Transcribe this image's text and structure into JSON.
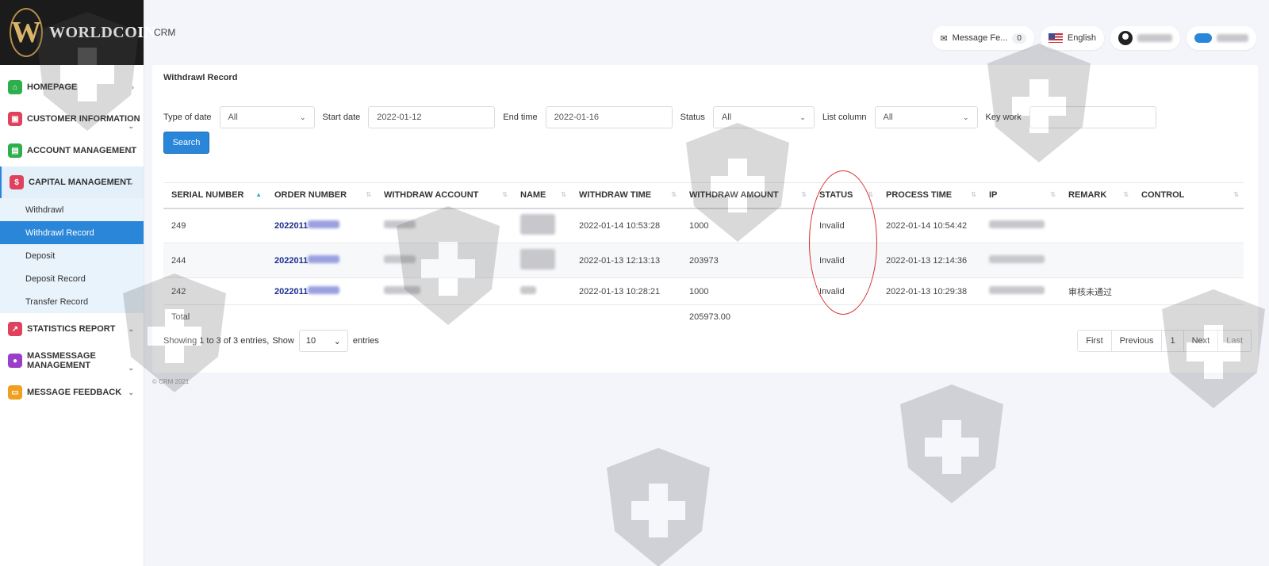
{
  "brand": {
    "logo_letter": "W",
    "name": "WORLDCOIN"
  },
  "header": {
    "crm_label": "CRM",
    "message_feedback_label": "Message Fe...",
    "message_count": "0",
    "language": "English"
  },
  "sidebar": {
    "items": [
      {
        "label": "HOMEPAGE",
        "icon": "home-icon",
        "color": "#2eaf4b",
        "chev": "›"
      },
      {
        "label": "CUSTOMER INFORMATION",
        "icon": "id-card-icon",
        "color": "#e0425e",
        "chev": "⌄"
      },
      {
        "label": "ACCOUNT MANAGEMENT",
        "icon": "account-icon",
        "color": "#2eaf4b",
        "chev": "⌄"
      },
      {
        "label": "CAPITAL MANAGEMENT",
        "icon": "dollar-icon",
        "color": "#e0425e",
        "chev": "⌄"
      },
      {
        "label": "STATISTICS REPORT",
        "icon": "chart-icon",
        "color": "#e0425e",
        "chev": "⌄"
      },
      {
        "label": "MASSMESSAGE MANAGEMENT",
        "icon": "chat-icon",
        "color": "#9b3ec9",
        "chev": "⌄"
      },
      {
        "label": "MESSAGE FEEDBACK",
        "icon": "inbox-icon",
        "color": "#f0a020",
        "chev": "⌄"
      }
    ],
    "capital_sub": [
      "Withdrawl",
      "Withdrawl Record",
      "Deposit",
      "Deposit Record",
      "Transfer Record"
    ]
  },
  "page": {
    "title": "Withdrawl Record",
    "filters": {
      "type_of_date_label": "Type of date",
      "type_of_date_value": "All",
      "start_date_label": "Start date",
      "start_date_value": "2022-01-12",
      "end_time_label": "End time",
      "end_time_value": "2022-01-16",
      "status_label": "Status",
      "status_value": "All",
      "list_column_label": "List column",
      "list_column_value": "All",
      "key_work_label": "Key work",
      "key_work_value": ""
    },
    "search_label": "Search"
  },
  "table": {
    "columns": [
      "SERIAL NUMBER",
      "ORDER NUMBER",
      "WITHDRAW ACCOUNT",
      "NAME",
      "WITHDRAW TIME",
      "WITHDRAW AMOUNT",
      "STATUS",
      "PROCESS TIME",
      "IP",
      "REMARK",
      "CONTROL"
    ],
    "rows": [
      {
        "serial": "249",
        "order": "2022011",
        "withdraw_time": "2022-01-14 10:53:28",
        "amount": "1000",
        "status": "Invalid",
        "process_time": "2022-01-14 10:54:42",
        "remark": ""
      },
      {
        "serial": "244",
        "order": "2022011",
        "withdraw_time": "2022-01-13 12:13:13",
        "amount": "203973",
        "status": "Invalid",
        "process_time": "2022-01-13 12:14:36",
        "remark": ""
      },
      {
        "serial": "242",
        "order": "2022011",
        "withdraw_time": "2022-01-13 10:28:21",
        "amount": "1000",
        "status": "Invalid",
        "process_time": "2022-01-13 10:29:38",
        "remark": "审核未通过"
      }
    ],
    "total_label": "Total",
    "total_amount": "205973.00"
  },
  "footer": {
    "showing": "Showing 1 to 3 of 3 entries,",
    "show_label": "Show",
    "page_size": "10",
    "entries_label": "entries",
    "pager": [
      "First",
      "Previous",
      "1",
      "Next",
      "Last"
    ],
    "copyright": "© CRM 2021"
  }
}
